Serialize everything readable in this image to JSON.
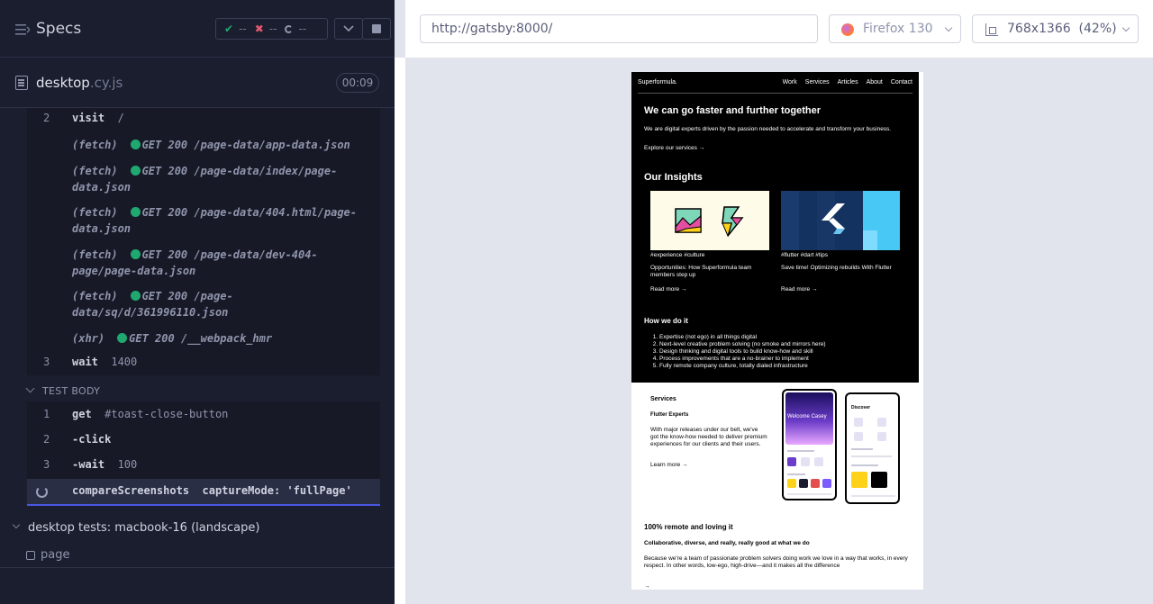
{
  "specs": {
    "title": "Specs",
    "stats": {
      "passed": "--",
      "failed": "--",
      "pending": "--"
    }
  },
  "spec_file": {
    "name": "desktop",
    "ext": ".cy.js",
    "duration": "00:09"
  },
  "before_commands": [
    {
      "num": "2",
      "name": "visit",
      "arg": "/"
    },
    {
      "prefix": "(fetch)",
      "method": "GET 200",
      "path": "/page-data/app-data.json"
    },
    {
      "prefix": "(fetch)",
      "method": "GET 200",
      "path": "/page-data/index/page-data.json"
    },
    {
      "prefix": "(fetch)",
      "method": "GET 200",
      "path": "/page-data/404.html/page-data.json"
    },
    {
      "prefix": "(fetch)",
      "method": "GET 200",
      "path": "/page-data/dev-404-page/page-data.json"
    },
    {
      "prefix": "(fetch)",
      "method": "GET 200",
      "path": "/page-data/sq/d/361996110.json"
    },
    {
      "prefix": "(xhr)",
      "method": "GET 200",
      "path": "/__webpack_hmr"
    },
    {
      "num": "3",
      "name": "wait",
      "arg": "1400"
    }
  ],
  "test_body": {
    "header": "TEST BODY",
    "commands": [
      {
        "num": "1",
        "name": "get",
        "arg": "#toast-close-button"
      },
      {
        "num": "2",
        "name": "-click",
        "arg": ""
      },
      {
        "num": "3",
        "name": "-wait",
        "arg": "100"
      },
      {
        "num": "",
        "name": "compareScreenshots",
        "arg": "captureMode: 'fullPage'"
      }
    ]
  },
  "suite": {
    "title": "desktop tests: macbook-16 (landscape)",
    "test": "page"
  },
  "browser_bar": {
    "url": "http://gatsby:8000/",
    "browser": "Firefox 130",
    "viewport": "768x1366  (42%)"
  },
  "site": {
    "logo": "Superformula.",
    "nav": [
      "Work",
      "Services",
      "Articles",
      "About",
      "Contact"
    ],
    "hero_title": "We can go faster and further together",
    "hero_text": "We are digital experts driven by the passion needed to accelerate and transform your business.",
    "hero_link": "Explore our services →",
    "insights_title": "Our Insights",
    "cards": [
      {
        "tags": "#experience #culture",
        "title": "Opportunities: How Superformula team members step up",
        "link": "Read more →"
      },
      {
        "tags": "#flutter #dart #tips",
        "title": "Save time! Optimizing rebuilds With Flutter",
        "link": "Read more →"
      }
    ],
    "how_title": "How we do it",
    "how_list": [
      "Expertise (not ego) in all things digital",
      "Next-level creative problem solving (no smoke and mirrors here)",
      "Design thinking and digital tools to build know-how and skill",
      "Process improvements that are a no-brainer to implement",
      "Fully remote company culture, totally dialed infrastructure"
    ],
    "services_title": "Services",
    "services_sub": "Flutter Experts",
    "services_text": "With major releases under our belt, we've got the know-how needed to deliver premium experiences for our clients and their users.",
    "services_link": "Learn more →",
    "phone_welcome": "Welcome Casey",
    "phone_discover": "Discover",
    "remote_title": "100% remote and loving it",
    "remote_sub": "Collaborative, diverse, and really, really good at what we do",
    "remote_text": "Because we're a team of passionate problem solvers doing work we love in a way that works, in every respect. In other words, low-ego, high-drive—and it makes all the difference",
    "remote_arrow": "→"
  }
}
